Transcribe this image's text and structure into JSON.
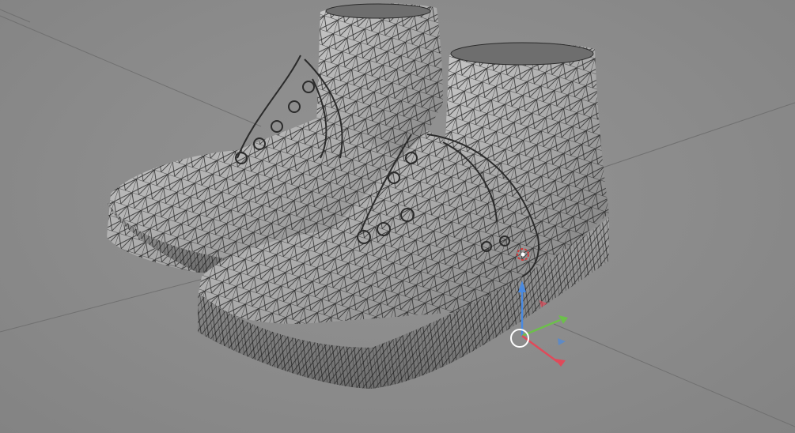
{
  "viewport": {
    "background": "#8a8a8a",
    "grid_color": "#6f6f6f",
    "mesh_fill": "#a9a9a9",
    "mesh_wire": "#2b2b2b",
    "object": "sneaker-pair-wireframe-mesh"
  },
  "gizmo": {
    "axes": [
      {
        "name": "x-axis",
        "color": "#e04a5a"
      },
      {
        "name": "y-axis",
        "color": "#6cc04a"
      },
      {
        "name": "z-axis",
        "color": "#4a8ae0"
      }
    ],
    "pivot_color": "#ffffff",
    "target_color": "#d23a3a"
  }
}
